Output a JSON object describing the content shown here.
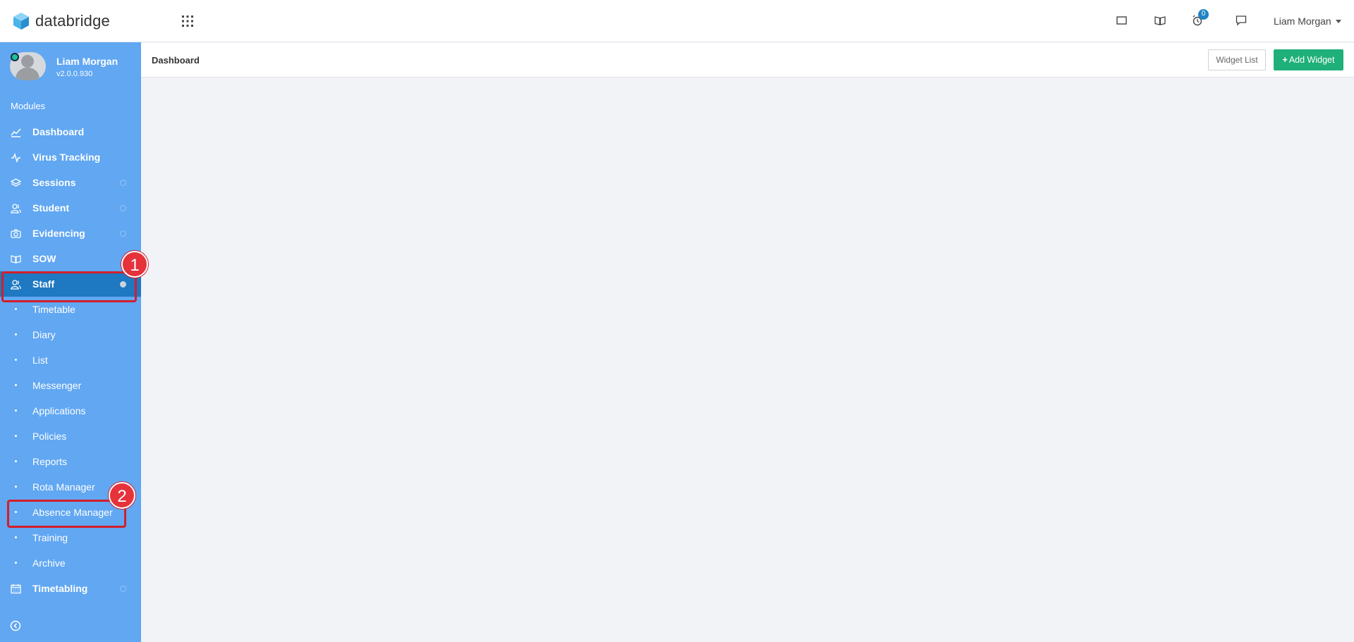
{
  "app": {
    "brand": "databridge"
  },
  "topbar": {
    "icons": [
      "window-icon",
      "book-icon",
      "alarm-icon",
      "chat-icon"
    ],
    "alarm_badge": "0",
    "user_name": "Liam Morgan"
  },
  "sidebar": {
    "profile": {
      "name": "Liam Morgan",
      "version": "v2.0.0.930"
    },
    "section_label": "Modules",
    "items": [
      {
        "label": "Dashboard",
        "icon": "chart-line-icon"
      },
      {
        "label": "Virus Tracking",
        "icon": "pulse-icon"
      },
      {
        "label": "Sessions",
        "icon": "layers-icon"
      },
      {
        "label": "Student",
        "icon": "users-icon"
      },
      {
        "label": "Evidencing",
        "icon": "camera-icon"
      },
      {
        "label": "SOW",
        "icon": "book-open-icon"
      },
      {
        "label": "Staff",
        "icon": "users-icon"
      },
      {
        "label": "Timetable"
      },
      {
        "label": "Diary"
      },
      {
        "label": "List"
      },
      {
        "label": "Messenger"
      },
      {
        "label": "Applications"
      },
      {
        "label": "Policies"
      },
      {
        "label": "Reports"
      },
      {
        "label": "Rota Manager"
      },
      {
        "label": "Absence Manager"
      },
      {
        "label": "Training"
      },
      {
        "label": "Archive"
      },
      {
        "label": "Timetabling",
        "icon": "calendar-icon"
      }
    ]
  },
  "content": {
    "title": "Dashboard",
    "widget_list_label": "Widget List",
    "add_widget_label": "Add Widget",
    "add_widget_prefix": "+"
  },
  "annotations": {
    "step1": "1",
    "step2": "2"
  },
  "colors": {
    "sidebar": "#61a7f2",
    "active": "#1e78c2",
    "accent_green": "#1fb07a",
    "annotation_red": "#d21f2a"
  }
}
